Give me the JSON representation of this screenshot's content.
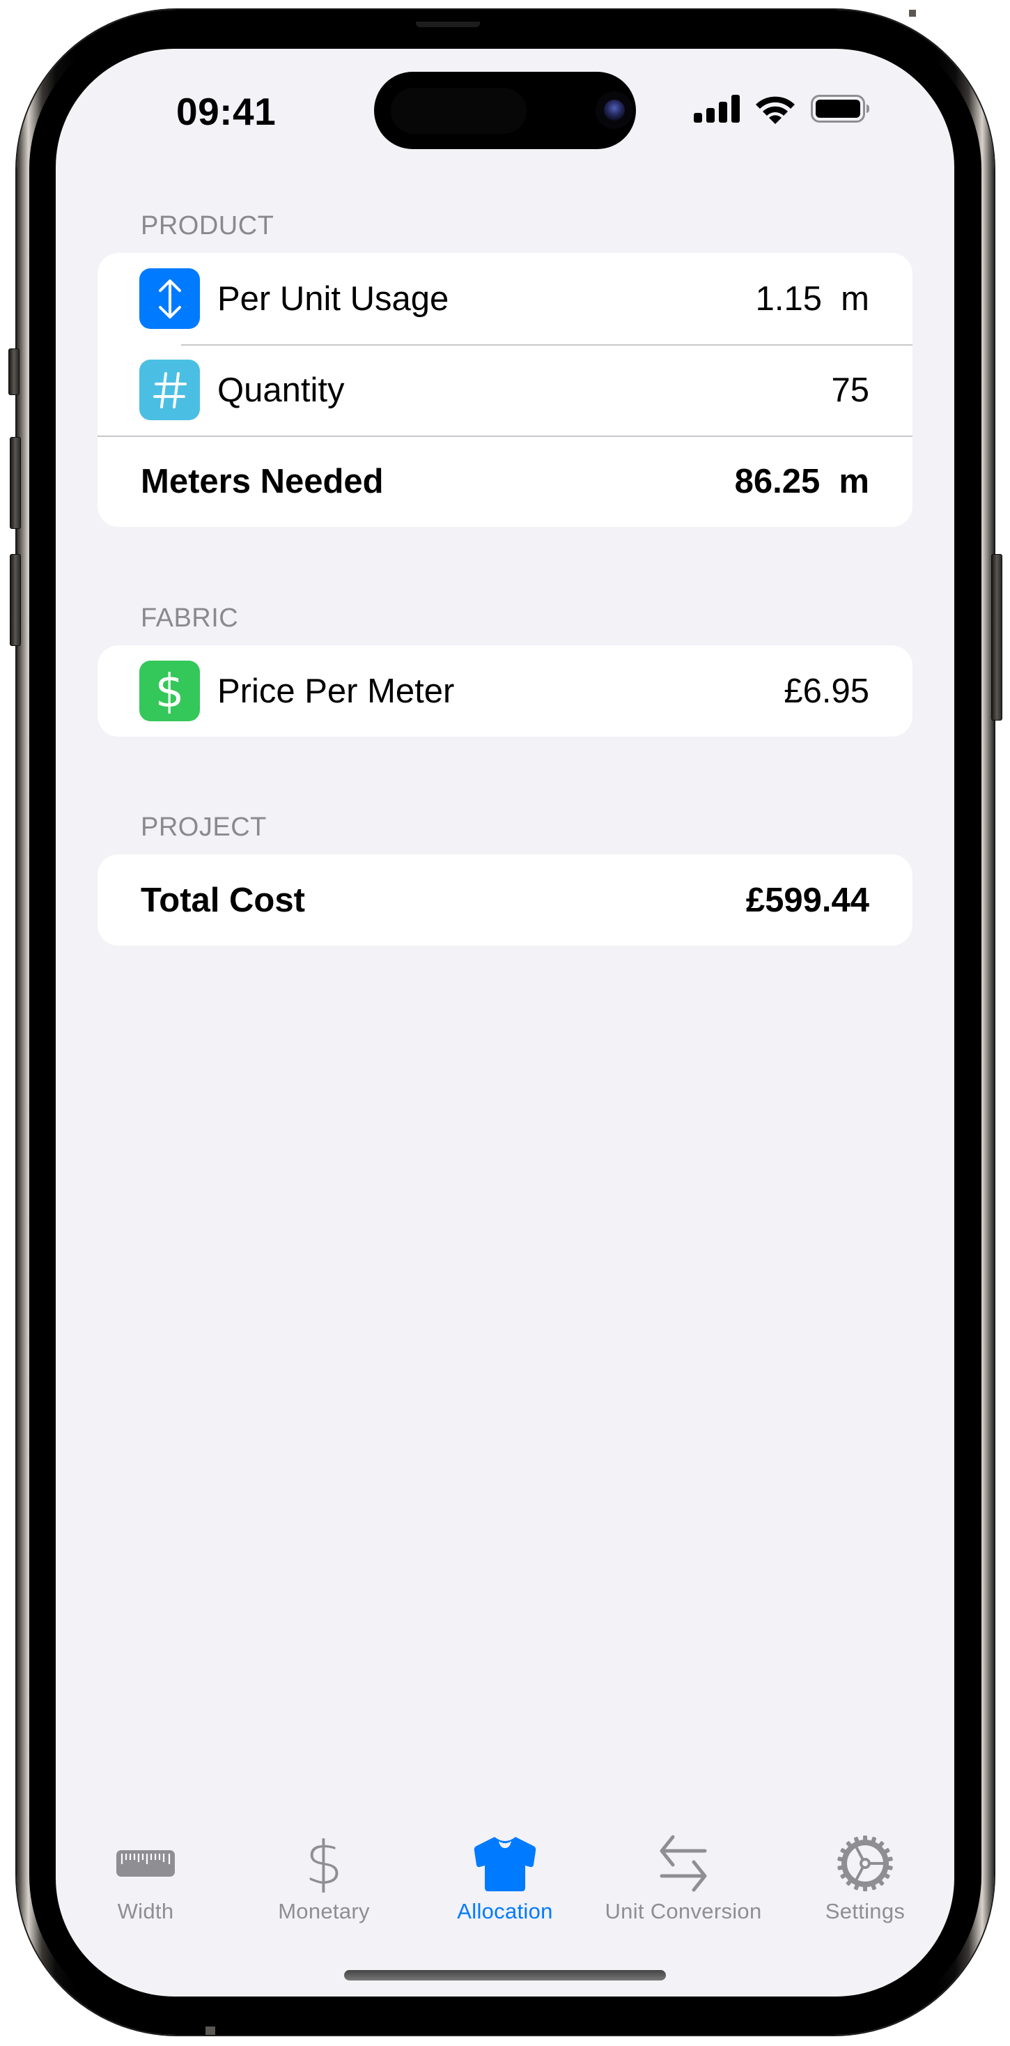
{
  "status_bar": {
    "time": "09:41",
    "icons": [
      "cellular-signal-icon",
      "wifi-icon",
      "battery-icon"
    ]
  },
  "sections": [
    {
      "header": "PRODUCT",
      "rows": [
        {
          "icon": "arrow-up-down-icon",
          "icon_color": "#007aff",
          "label": "Per Unit Usage",
          "value": "1.15  m"
        },
        {
          "icon": "number-sign-icon",
          "icon_color": "#4bbfe3",
          "label": "Quantity",
          "value": "75"
        },
        {
          "label": "Meters Needed",
          "value": "86.25  m",
          "bold": true
        }
      ]
    },
    {
      "header": "FABRIC",
      "rows": [
        {
          "icon": "dollar-sign-icon",
          "icon_color": "#34c759",
          "label": "Price Per Meter",
          "value": "£6.95"
        }
      ]
    },
    {
      "header": "PROJECT",
      "rows": [
        {
          "label": "Total Cost",
          "value": "£599.44",
          "bold": true
        }
      ]
    }
  ],
  "tab_bar": {
    "active": "Allocation",
    "tabs": [
      {
        "label": "Width",
        "icon": "ruler-icon"
      },
      {
        "label": "Monetary",
        "icon": "dollar-sign-icon"
      },
      {
        "label": "Allocation",
        "icon": "tshirt-icon"
      },
      {
        "label": "Unit Conversion",
        "icon": "arrows-left-right-icon"
      },
      {
        "label": "Settings",
        "icon": "gear-icon"
      }
    ]
  },
  "colors": {
    "accent": "#007aff",
    "inactive_tab": "#8e8e93",
    "background": "#f2f2f7",
    "section_header": "#8a8a8e"
  }
}
